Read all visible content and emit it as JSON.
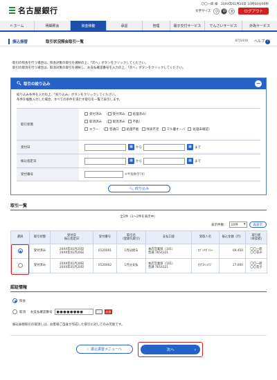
{
  "header": {
    "bank_name": "名古屋銀行",
    "user_line": "〇〇一郎 様　20XX年01月20日 10時00分00秒",
    "font_size_label": "文字サイズ",
    "font_sizes": [
      "小",
      "中",
      "大"
    ],
    "logout_label": "ログアウト"
  },
  "gnav": {
    "home_label": "ホーム",
    "items": [
      "明細照会",
      "資金移動",
      "承認",
      "管理",
      "電子交付サービス",
      "でんさいサービス",
      "外為サービス"
    ],
    "active_index": 1
  },
  "title_bar": {
    "category": "振込振替",
    "title": "取引状況照会取引一覧",
    "screen_id": "BTJS008",
    "help_label": "ヘルプ"
  },
  "intro": {
    "line1": "取引の照会を行う場合は、照会対象の取引を選択の上、「次へ」ボタンをクリックしてください。",
    "line2": "取引の取消を行う場合は、取消対象の取引を選択し、お支払確認番号を入力の上、「次へ」ボタンをクリックしてください。"
  },
  "filter": {
    "title": "取引の絞り込み",
    "desc1": "絞り込み条件を入力の上、「絞り込み」ボタンをクリックしてください。",
    "desc2": "条件を複数入力した場合、すべての条件を満たす取引を一覧で表示します。",
    "status_label": "取引状態",
    "status_row1": [
      "受付済み",
      "受付済み",
      "処理済み"
    ],
    "status_row2": [
      "取消済み",
      "取消済み",
      "不能"
    ],
    "status_row3": [
      "エラー",
      "普通口",
      "処理不能",
      "残高不足",
      "マル優オーバ",
      "処理未確認"
    ],
    "accept_date_label": "受付日",
    "transfer_date_label": "振込指定日",
    "from_label": "から",
    "to_label": "まで",
    "accept_no_label": "受付番号",
    "accept_no_hint": "※半角数字7桁",
    "search_button": "絞り込み"
  },
  "list": {
    "section_title": "取引一覧",
    "count_text": "全2件（1〜2件を表示中）",
    "per_page_label": "表示件数：",
    "per_page_value": "10件",
    "redisplay_label": "再表示",
    "columns": [
      "選択",
      "取引状態",
      "受付日\n振込指定日",
      "受付番号",
      "取引名\n(登録先取引)",
      "支払口座",
      "受取人名",
      "振込金額（円）",
      "取引者\n(承認者)"
    ],
    "rows": [
      {
        "selected": true,
        "status": "受付済み",
        "date1": "20XX年01月20日",
        "date2": "20XX年01月20日",
        "accept_no": "0120001",
        "name": "1月分給与",
        "account1": "本店営業部（101）",
        "account2": "普通 7654321",
        "payee": "ｶﾌﾞｼｷｶﾞｲｼｬ",
        "amount": "69,450",
        "user1": "〇〇一郎",
        "user2": "〇〇花子"
      },
      {
        "selected": false,
        "status": "受付済み",
        "date1": "20XX年01月20日",
        "date2": "20XX年01月20日",
        "accept_no": "0120002",
        "name": "1月分支払",
        "account1": "本店営業部（101）",
        "account2": "普通 7654321",
        "payee": "ｶ)ﾃｽﾄｼｮｳｼﾞ",
        "amount": "27,000",
        "user1": "〇〇一郎",
        "user2": "〇〇花子"
      }
    ]
  },
  "auth": {
    "section_title": "認証情報",
    "option_none": "照会",
    "option_cancel": "取消",
    "pw_label": "お支払確認番号",
    "pw_value": "●●●●●●●●",
    "required_label": "必須",
    "note": "振込振替取引の取消しは、お客様ご自身が作成した取引に対してのみ可能です。"
  },
  "footer": {
    "back_label": "振込振替メニューへ",
    "next_label": "次へ"
  }
}
